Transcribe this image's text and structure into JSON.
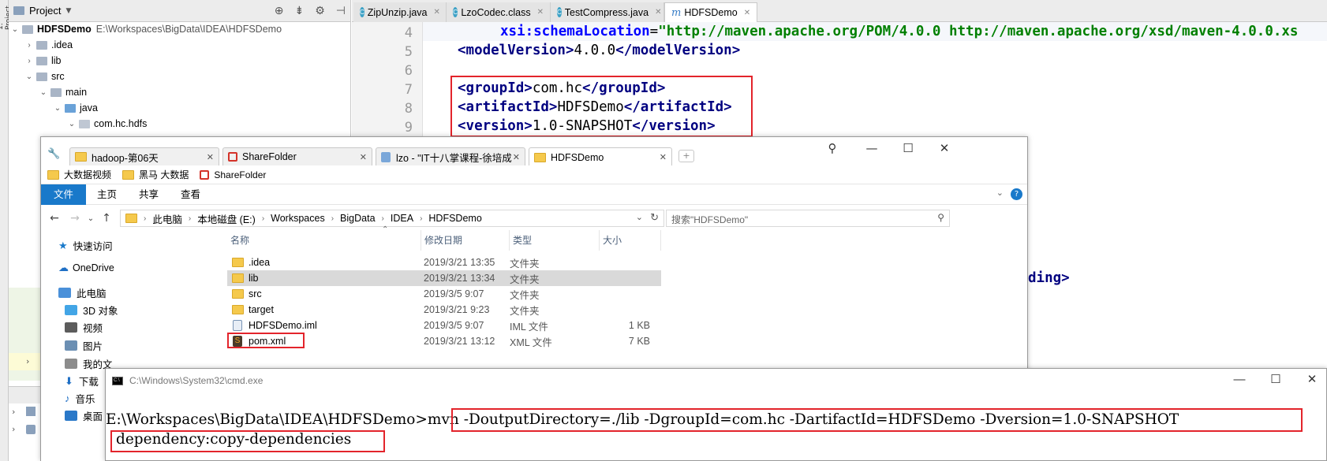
{
  "ide": {
    "left_strip_label": "1: Project",
    "project_panel": {
      "title": "Project",
      "tree": [
        {
          "label": "HDFSDemo",
          "path": "E:\\Workspaces\\BigData\\IDEA\\HDFSDemo"
        },
        {
          "label": ".idea"
        },
        {
          "label": "lib"
        },
        {
          "label": "src"
        },
        {
          "label": "main"
        },
        {
          "label": "java"
        },
        {
          "label": "com.hc.hdfs"
        }
      ]
    },
    "tabs": [
      {
        "label": "ZipUnzip.java",
        "icon": "C"
      },
      {
        "label": "LzoCodec.class",
        "icon": "C"
      },
      {
        "label": "TestCompress.java",
        "icon": "C"
      },
      {
        "label": "HDFSDemo",
        "icon": "m"
      }
    ],
    "editor": {
      "line_numbers": [
        "4",
        "5",
        "6",
        "7",
        "8",
        "9"
      ],
      "line4": {
        "attr": "xsi:schemaLocation",
        "eq": "=",
        "value": "\"http://maven.apache.org/POM/4.0.0 http://maven.apache.org/xsd/maven-4.0.0.xs"
      },
      "line5": {
        "open": "<modelVersion>",
        "text": "4.0.0",
        "close": "</modelVersion>"
      },
      "line7": {
        "open": "<groupId>",
        "text": "com.hc",
        "close": "</groupId>"
      },
      "line8": {
        "open": "<artifactId>",
        "text": "HDFSDemo",
        "close": "</artifactId>"
      },
      "line9": {
        "open": "<version>",
        "text": "1.0-SNAPSHOT",
        "close": "</version>"
      },
      "partial": "ding>"
    }
  },
  "explorer": {
    "tabs": [
      "hadoop-第06天",
      "ShareFolder",
      "lzo - \"IT十八掌课程-徐培成",
      "HDFSDemo"
    ],
    "favorites": [
      "大数据视频",
      "黑马 大数据",
      "ShareFolder"
    ],
    "ribbon": [
      "文件",
      "主页",
      "共享",
      "查看"
    ],
    "breadcrumb": [
      "此电脑",
      "本地磁盘 (E:)",
      "Workspaces",
      "BigData",
      "IDEA",
      "HDFSDemo"
    ],
    "search_placeholder": "搜索\"HDFSDemo\"",
    "nav": [
      "快速访问",
      "OneDrive",
      "此电脑",
      "3D 对象",
      "视频",
      "图片",
      "我的文",
      "下载",
      "音乐",
      "桌面"
    ],
    "columns": [
      "名称",
      "修改日期",
      "类型",
      "大小"
    ],
    "files": [
      {
        "name": ".idea",
        "date": "2019/3/21 13:35",
        "type": "文件夹",
        "size": ""
      },
      {
        "name": "lib",
        "date": "2019/3/21 13:34",
        "type": "文件夹",
        "size": ""
      },
      {
        "name": "src",
        "date": "2019/3/5 9:07",
        "type": "文件夹",
        "size": ""
      },
      {
        "name": "target",
        "date": "2019/3/21 9:23",
        "type": "文件夹",
        "size": ""
      },
      {
        "name": "HDFSDemo.iml",
        "date": "2019/3/5 9:07",
        "type": "IML 文件",
        "size": "1 KB"
      },
      {
        "name": "pom.xml",
        "date": "2019/3/21 13:12",
        "type": "XML 文件",
        "size": "7 KB"
      }
    ]
  },
  "cmd": {
    "title": "C:\\Windows\\System32\\cmd.exe",
    "prompt": "E:\\Workspaces\\BigData\\IDEA\\HDFSDemo>",
    "command": "mvn -DoutputDirectory=./lib -DgroupId=com.hc -DartifactId=HDFSDemo -Dversion=1.0-SNAPSHOT",
    "command_cont": "dependency:copy-dependencies"
  },
  "colors": {
    "highlight_box": "#e3242b",
    "ribbon_file": "#1979ca",
    "selected_row": "#d9d9d9"
  }
}
